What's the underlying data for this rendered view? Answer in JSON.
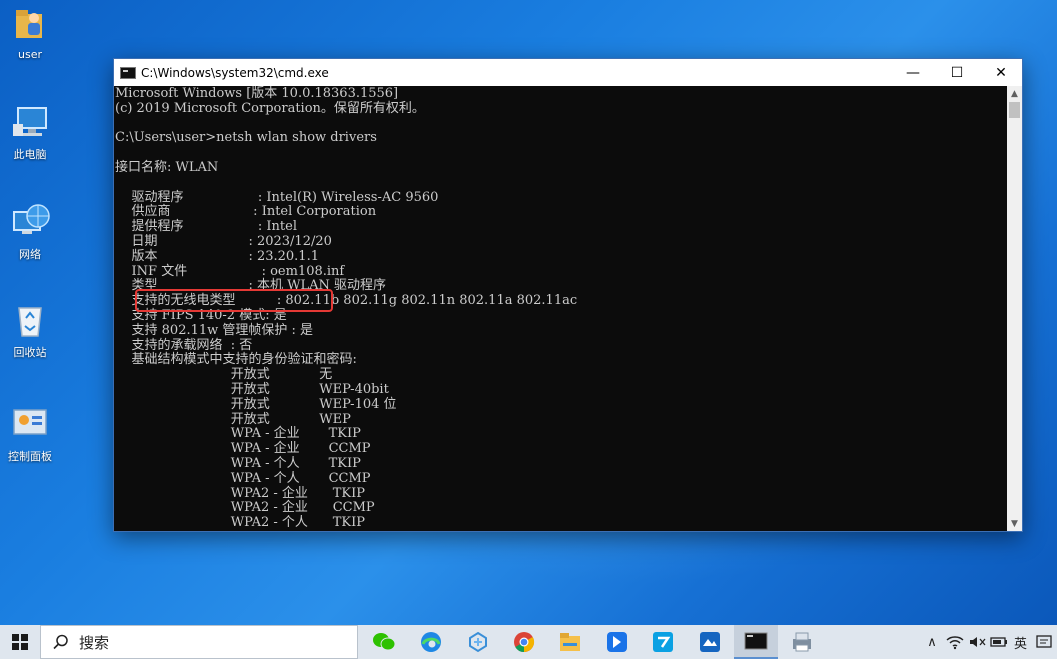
{
  "desktop": {
    "icons": [
      {
        "label": "user",
        "icon": "user-folder-icon"
      },
      {
        "label": "此电脑",
        "icon": "this-pc-icon"
      },
      {
        "label": "网络",
        "icon": "network-icon"
      },
      {
        "label": "回收站",
        "icon": "recycle-bin-icon"
      },
      {
        "label": "控制面板",
        "icon": "control-panel-icon"
      }
    ]
  },
  "window": {
    "title": "C:\\Windows\\system32\\cmd.exe",
    "minimize_glyph": "—",
    "maximize_glyph": "☐",
    "close_glyph": "✕",
    "console_lines": [
      "Microsoft Windows [版本 10.0.18363.1556]",
      "(c) 2019 Microsoft Corporation。保留所有权利。",
      "",
      "C:\\Users\\user>netsh wlan show drivers",
      "",
      "接口名称: WLAN",
      "",
      "    驱动程序                  : Intel(R) Wireless-AC 9560",
      "    供应商                    : Intel Corporation",
      "    提供程序                  : Intel",
      "    日期                      : 2023/12/20",
      "    版本                      : 23.20.1.1",
      "    INF 文件                  : oem108.inf",
      "    类型                      : 本机 WLAN 驱动程序",
      "    支持的无线电类型          : 802.11b 802.11g 802.11n 802.11a 802.11ac",
      "    支持 FIPS 140-2 模式: 是",
      "    支持 802.11w 管理帧保护 : 是",
      "    支持的承载网络  : 否",
      "    基础结构模式中支持的身份验证和密码:",
      "                            开放式            无",
      "                            开放式            WEP-40bit",
      "                            开放式            WEP-104 位",
      "                            开放式            WEP",
      "                            WPA - 企业       TKIP",
      "                            WPA - 企业       CCMP",
      "                            WPA - 个人       TKIP",
      "                            WPA - 个人       CCMP",
      "                            WPA2 - 企业      TKIP",
      "                            WPA2 - 企业      CCMP",
      "                            WPA2 - 个人      TKIP"
    ]
  },
  "taskbar": {
    "search_label": "搜索",
    "apps": [
      "wechat-icon",
      "edge-icon",
      "network-sync-icon",
      "chrome-icon",
      "file-explorer-icon",
      "feishu-icon",
      "tool-icon",
      "lark-icon",
      "cmd-icon",
      "printer-app-icon"
    ],
    "tray": {
      "chevron": "∧",
      "ime": "英"
    }
  },
  "colors": {
    "console_bg": "#0c0c0c",
    "console_text": "#cccccc",
    "highlight": "#e53935",
    "taskbar_bg": "#dfe6ee"
  }
}
